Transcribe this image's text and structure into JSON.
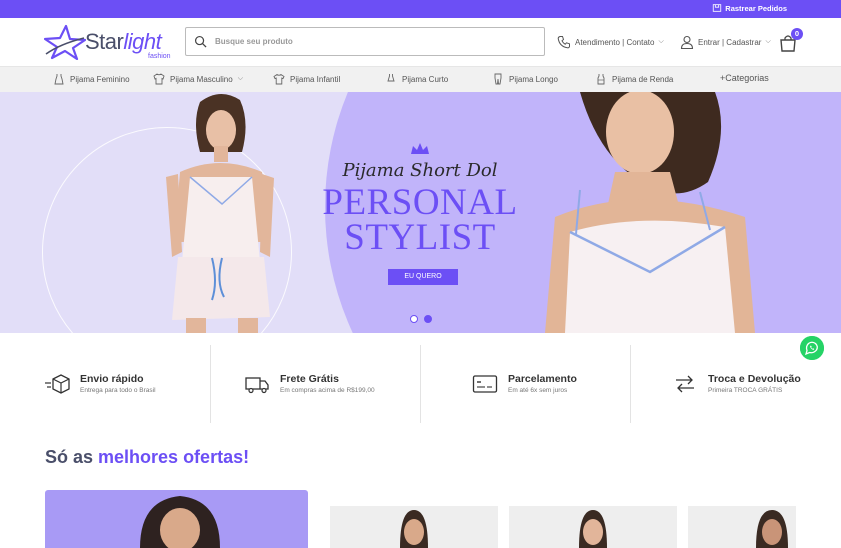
{
  "topbar": {
    "track_label": "Rastrear Pedidos"
  },
  "header": {
    "logo_main": "Star",
    "logo_italic": "light",
    "logo_sub": "fashion",
    "search_placeholder": "Busque seu produto",
    "contact_label": "Atendimento | Contato",
    "account_label": "Entrar | Cadastrar",
    "cart_count": "0"
  },
  "nav": {
    "items": [
      {
        "label": "Pijama Feminino",
        "icon": "dress-icon"
      },
      {
        "label": "Pijama Masculino",
        "icon": "shirt-icon"
      },
      {
        "label": "Pijama Infantil",
        "icon": "tshirt-icon"
      },
      {
        "label": "Pijama Curto",
        "icon": "short-dress-icon"
      },
      {
        "label": "Pijama Longo",
        "icon": "long-pajama-icon"
      },
      {
        "label": "Pijama de Renda",
        "icon": "lace-icon"
      },
      {
        "label": "+Categorias",
        "icon": ""
      }
    ]
  },
  "hero": {
    "subtitle": "Pijama Short Dol",
    "title_line1": "PERSONAL",
    "title_line2": "STYLIST",
    "cta": "EU QUERO",
    "slides": 2,
    "active_slide": 2
  },
  "features": [
    {
      "title": "Envio rápido",
      "sub": "Entrega para todo o Brasil",
      "icon": "fast-box-icon"
    },
    {
      "title": "Frete Grátis",
      "sub": "Em compras acima de R$199,00",
      "icon": "truck-icon"
    },
    {
      "title": "Parcelamento",
      "sub": "Em até 6x sem juros",
      "icon": "credit-card-icon"
    },
    {
      "title": "Troca e Devolução",
      "sub": "Primeira TROCA GRÁTIS",
      "icon": "exchange-icon"
    }
  ],
  "offers": {
    "title_prefix": "Só as ",
    "title_highlight": "melhores ofertas!"
  },
  "colors": {
    "brand": "#6c4ff5",
    "hero_circle": "#c1b4fa",
    "whatsapp": "#25d366"
  }
}
